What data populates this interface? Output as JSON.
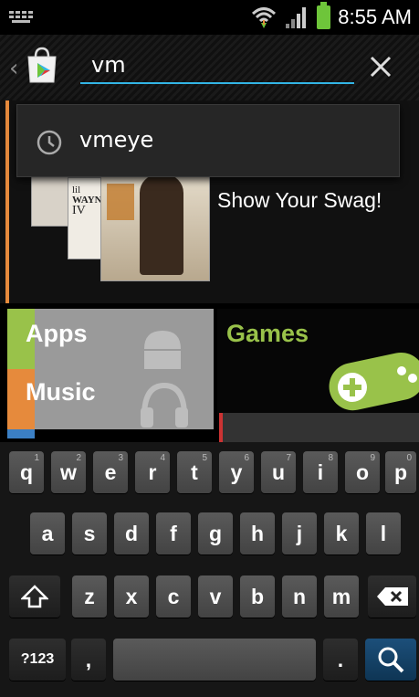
{
  "status_bar": {
    "time": "8:55 AM",
    "icons": [
      "keyboard-indicator-icon",
      "wifi-icon",
      "signal-icon",
      "battery-icon"
    ]
  },
  "search": {
    "query": "vm",
    "back_icon": "back-chevron-icon",
    "app_icon": "play-store-icon",
    "clear_icon": "close-icon",
    "accent_color": "#33b5e5"
  },
  "suggestions": [
    {
      "icon": "history-clock-icon",
      "text": "vmeye"
    }
  ],
  "featured": {
    "promo_text": "Show Your Swag!",
    "album_lines": [
      "lil",
      "WAYN",
      "IV"
    ]
  },
  "categories": {
    "apps": {
      "label": "Apps",
      "color": "#99c24a"
    },
    "music": {
      "label": "Music",
      "color": "#e68a3c"
    },
    "games": {
      "label": "Games",
      "color": "#99c24a"
    }
  },
  "keyboard": {
    "row1": [
      {
        "key": "q",
        "hint": "1"
      },
      {
        "key": "w",
        "hint": "2"
      },
      {
        "key": "e",
        "hint": "3"
      },
      {
        "key": "r",
        "hint": "4"
      },
      {
        "key": "t",
        "hint": "5"
      },
      {
        "key": "y",
        "hint": "6"
      },
      {
        "key": "u",
        "hint": "7"
      },
      {
        "key": "i",
        "hint": "8"
      },
      {
        "key": "o",
        "hint": "9"
      },
      {
        "key": "p",
        "hint": "0"
      }
    ],
    "row2": [
      "a",
      "s",
      "d",
      "f",
      "g",
      "h",
      "j",
      "k",
      "l"
    ],
    "row3": [
      "z",
      "x",
      "c",
      "v",
      "b",
      "n",
      "m"
    ],
    "shift_icon": "shift-arrow-icon",
    "backspace_icon": "backspace-icon",
    "symbols_label": "?123",
    "comma_label": ",",
    "period_label": ".",
    "search_icon": "search-icon"
  }
}
